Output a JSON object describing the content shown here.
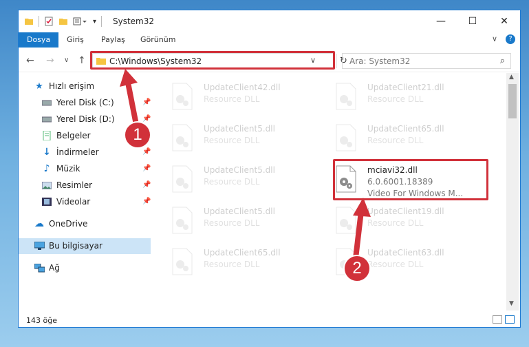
{
  "window": {
    "title": "System32"
  },
  "ribbon": {
    "tabs": [
      "Dosya",
      "Giriş",
      "Paylaş",
      "Görünüm"
    ]
  },
  "address": {
    "path": "C:\\Windows\\System32",
    "search_placeholder": "Ara: System32"
  },
  "sidebar": {
    "quick_access": "Hızlı erişim",
    "items": [
      {
        "label": "Yerel Disk (C:)",
        "icon": "drive-icon",
        "pinned": true
      },
      {
        "label": "Yerel Disk (D:)",
        "icon": "drive-icon",
        "pinned": true
      },
      {
        "label": "Belgeler",
        "icon": "documents-icon",
        "pinned": true
      },
      {
        "label": "İndirmeler",
        "icon": "downloads-icon",
        "pinned": true
      },
      {
        "label": "Müzik",
        "icon": "music-icon",
        "pinned": true
      },
      {
        "label": "Resimler",
        "icon": "pictures-icon",
        "pinned": true
      },
      {
        "label": "Videolar",
        "icon": "videos-icon",
        "pinned": true
      }
    ],
    "onedrive": "OneDrive",
    "this_pc": "Bu bilgisayar",
    "network": "Ağ"
  },
  "files": [
    {
      "name": "UpdateClient42.dll",
      "desc": "Resource DLL",
      "faded": true
    },
    {
      "name": "UpdateClient21.dll",
      "desc": "Resource DLL",
      "faded": true
    },
    {
      "name": "UpdateClient5.dll",
      "desc": "Resource DLL",
      "faded": true
    },
    {
      "name": "UpdateClient65.dll",
      "desc": "Resource DLL",
      "faded": true
    },
    {
      "name": "UpdateClient5.dll",
      "desc": "Resource DLL",
      "faded": true
    },
    {
      "name": "mciavi32.dll",
      "version": "6.0.6001.18389",
      "desc": "Video For Windows M...",
      "faded": false
    },
    {
      "name": "UpdateClient5.dll",
      "desc": "Resource DLL",
      "faded": true
    },
    {
      "name": "UpdateClient19.dll",
      "desc": "Resource DLL",
      "faded": true
    },
    {
      "name": "UpdateClient65.dll",
      "desc": "Resource DLL",
      "faded": true
    },
    {
      "name": "UpdateClient63.dll",
      "desc": "Resource DLL",
      "faded": true
    }
  ],
  "status": {
    "count": "143 öğe"
  },
  "annotations": {
    "badge1": "1",
    "badge2": "2",
    "color": "#d1313a"
  }
}
